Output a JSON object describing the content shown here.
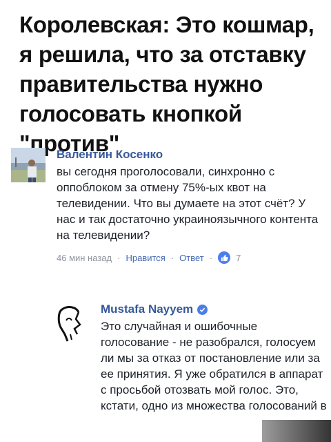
{
  "headline": "Королевская: Это кошмар, я решила, что за отставку правительства нужно голосовать кнопкой \"против\"",
  "comment": {
    "author": "Валентин Косенко",
    "text": "вы сегодня проголосовали, синхронно с оппоблоком за отмену 75%-ых квот на телевидении. Что вы думаете на этот счёт? У нас и так достаточно украиноязычного контента на телевидении?",
    "time": "46 мин назад",
    "like_label": "Нравится",
    "reply_label": "Ответ",
    "separator": "·",
    "like_count": "7",
    "avatar_icon": "person-photo-icon",
    "like_icon": "thumbs-up-icon"
  },
  "reply": {
    "author": "Mustafa Nayyem",
    "text": "Это случайная и ошибочные голосование - не разобрался, голосуем ли мы за отказ от постановление или за ее принятия. Я уже обратился в аппарат с просьбой отозвать мой голос.  Это, кстати, одно из множества голосований в",
    "avatar_icon": "profile-sketch-icon",
    "verified_icon": "verified-check-icon"
  },
  "colors": {
    "link": "#365899",
    "meta": "#90949c",
    "like_blue": "#4a7eea"
  }
}
